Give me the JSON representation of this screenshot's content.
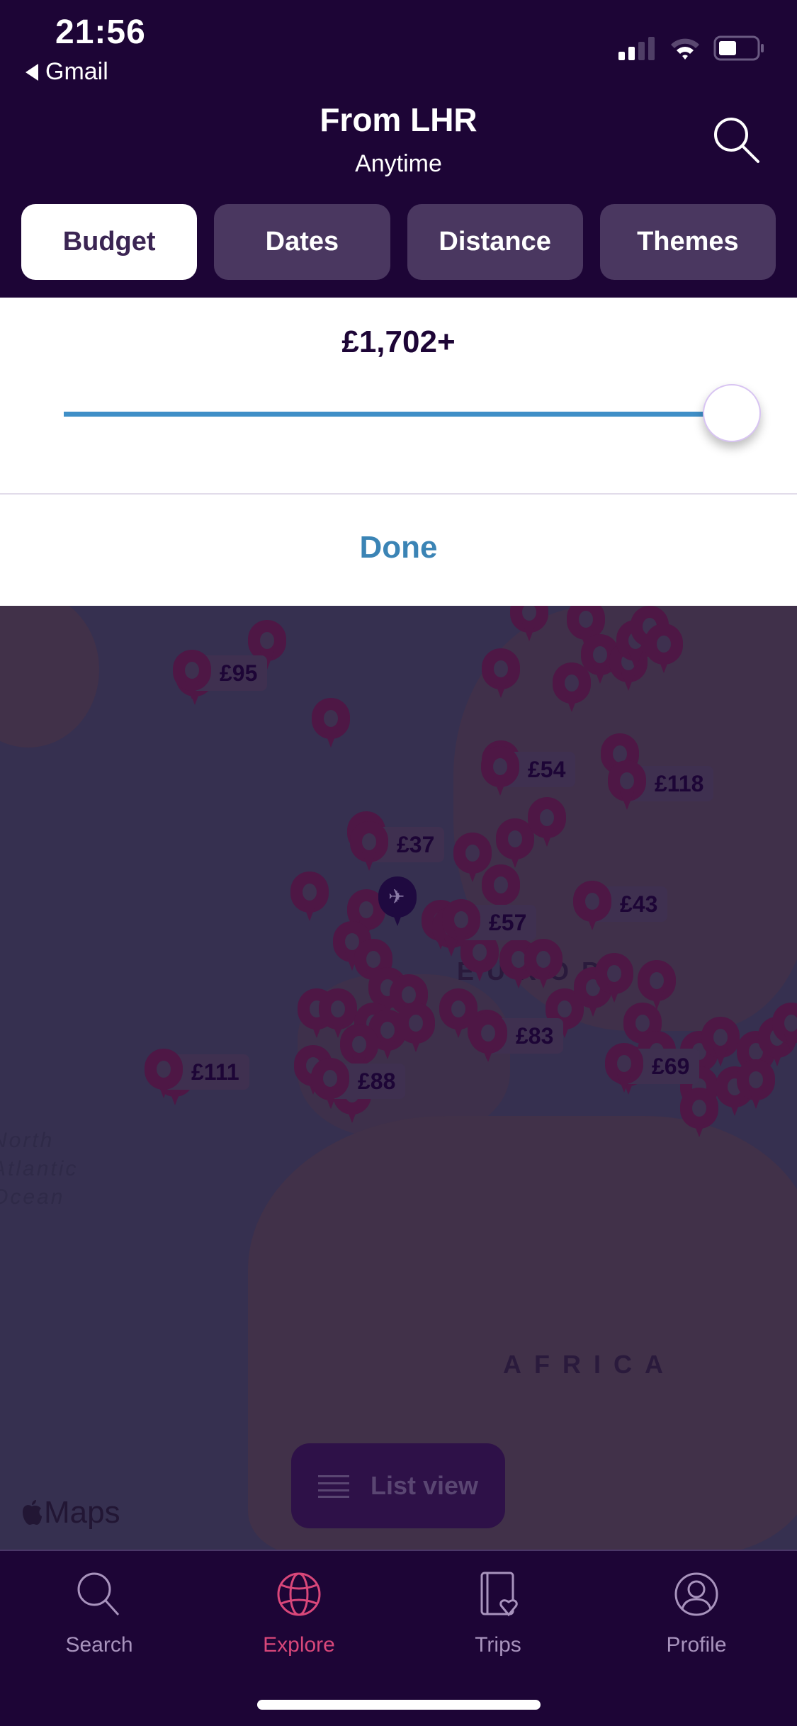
{
  "status_bar": {
    "time": "21:56",
    "back_app": "Gmail",
    "signal_bars": "2 of 4",
    "battery": "low-medium"
  },
  "header": {
    "title": "From LHR",
    "subtitle": "Anytime",
    "search_icon": "search-icon"
  },
  "filter_tabs": [
    {
      "label": "Budget",
      "active": true
    },
    {
      "label": "Dates",
      "active": false
    },
    {
      "label": "Distance",
      "active": false
    },
    {
      "label": "Themes",
      "active": false
    }
  ],
  "budget_panel": {
    "value_label": "£1,702+",
    "slider_fraction": 1.0,
    "done_label": "Done"
  },
  "map": {
    "region_labels": [
      "EUROPE",
      "AFRICA"
    ],
    "ocean_label": [
      "North",
      "Atlantic",
      "Ocean"
    ],
    "price_markers": [
      "£95",
      "£54",
      "£118",
      "£37",
      "£43",
      "£57",
      "£83",
      "£111",
      "£88",
      "£69"
    ],
    "attribution": "Maps",
    "list_view_label": "List view"
  },
  "tab_bar": [
    {
      "label": "Search",
      "icon": "search-icon",
      "active": false
    },
    {
      "label": "Explore",
      "icon": "globe-icon",
      "active": true
    },
    {
      "label": "Trips",
      "icon": "notebook-heart-icon",
      "active": false
    },
    {
      "label": "Profile",
      "icon": "user-circle-icon",
      "active": false
    }
  ],
  "colors": {
    "header_bg": "#1d0536",
    "tab_inactive": "#4a3760",
    "slider_track": "#3f8fc7",
    "done_text": "#3b84b5",
    "accent_active": "#d9477a",
    "pin": "#4e1745"
  }
}
